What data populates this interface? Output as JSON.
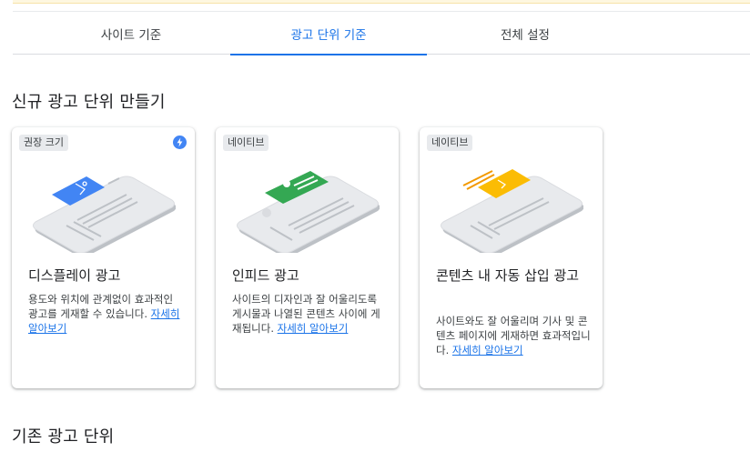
{
  "tabs": [
    {
      "label": "사이트 기준"
    },
    {
      "label": "광고 단위 기준"
    },
    {
      "label": "전체 설정"
    }
  ],
  "active_tab": "광고 단위 기준",
  "new_section_title": "신규 광고 단위 만들기",
  "cards": [
    {
      "chip": "권장 크기",
      "title": "디스플레이 광고",
      "desc": "용도와 위치에 관계없이 효과적인 광고를 게재할 수 있습니다.",
      "link": "자세히 알아보기",
      "accent": "#4285f4",
      "icon": "lightning-bolt-icon"
    },
    {
      "chip": "네이티브",
      "title": "인피드 광고",
      "desc": "사이트의 디자인과 잘 어울리도록 게시물과 나열된 콘텐츠 사이에 게재됩니다.",
      "link": "자세히 알아보기",
      "accent": "#34a853"
    },
    {
      "chip": "네이티브",
      "title": "콘텐츠 내 자동 삽입 광고",
      "desc": "사이트와도 잘 어울리며 기사 및 콘텐츠 페이지에 게재하면 효과적입니다.",
      "link": "자세히 알아보기",
      "accent": "#fbbc04"
    }
  ],
  "existing_section_title": "기존 광고 단위"
}
